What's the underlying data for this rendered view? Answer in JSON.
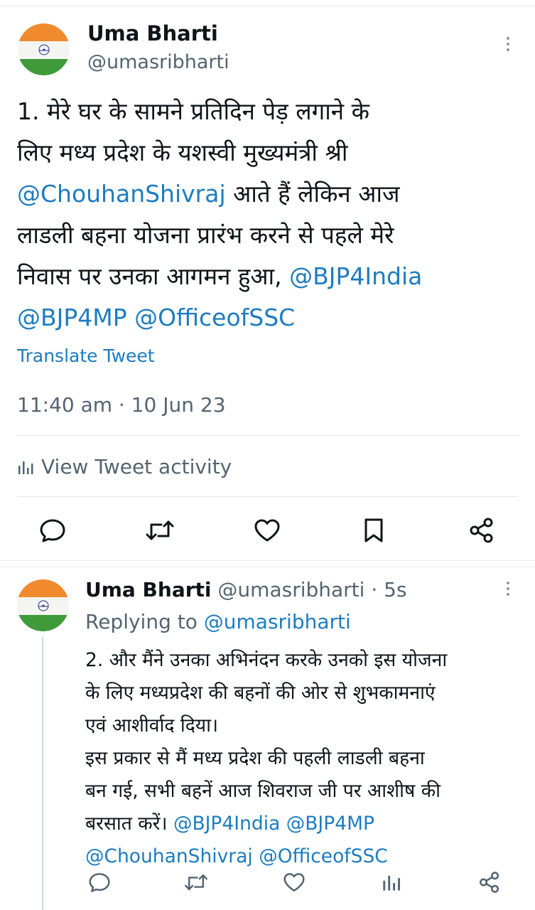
{
  "tweet": {
    "author_name": "Uma Bharti",
    "author_handle": "@umasribharti",
    "text_1": "1. मेरे घर के सामने प्रतिदिन पेड़ लगाने के\nलिए मध्य प्रदेश के यशस्वी मुख्यमंत्री श्री",
    "mention_1": "@ChouhanShivraj",
    "text_2": " आते हैं लेकिन आज\nलाडली बहना योजना प्रारंभ करने से पहले मेरे\nनिवास पर उनका आगमन हुआ, ",
    "mention_2": "@BJP4India",
    "mention_3": "@BJP4MP",
    "mention_4": "@OfficeofSSC",
    "translate_label": "Translate Tweet",
    "timestamp": "11:40 am · 10 Jun 23",
    "activity_label": "View Tweet activity"
  },
  "reply": {
    "author_name": "Uma Bharti",
    "author_handle": "@umasribharti",
    "time_ago": "5s",
    "replying_prefix": "Replying to ",
    "replying_handle": "@umasribharti",
    "text_1": "2. और मैंने उनका अभिनंदन करके उनको इस योजना\nके लिए मध्यप्रदेश की बहनों की ओर से शुभकामनाएं\nएवं आशीर्वाद दिया।\n इस प्रकार से मैं मध्य प्रदेश की पहली लाडली बहना\nबन गई, सभी बहनें आज शिवराज जी पर आशीष की\nबरसात करें। ",
    "mention_1": "@BJP4India",
    "mention_2": "@BJP4MP",
    "mention_3": "@ChouhanShivraj",
    "mention_4": "@OfficeofSSC"
  },
  "icons": {
    "reply": "reply-icon",
    "retweet": "retweet-icon",
    "like": "like-icon",
    "bookmark": "bookmark-icon",
    "share": "share-icon",
    "analytics": "analytics-icon",
    "more": "more-icon"
  },
  "colors": {
    "mention": "#1d7cc0",
    "icon_gray": "#536471"
  }
}
